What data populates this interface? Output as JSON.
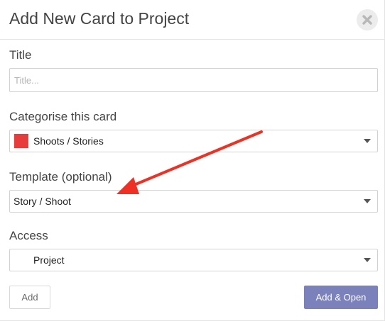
{
  "dialog": {
    "title": "Add New Card to Project",
    "close_icon": "close-icon"
  },
  "fields": {
    "title": {
      "label": "Title",
      "placeholder": "Title...",
      "value": ""
    },
    "category": {
      "label": "Categorise this card",
      "selected": "Shoots / Stories",
      "swatch_color": "#e83b3b"
    },
    "template": {
      "label": "Template (optional)",
      "selected": "Story / Shoot"
    },
    "access": {
      "label": "Access",
      "selected": "Project"
    }
  },
  "actions": {
    "add_label": "Add",
    "add_open_label": "Add & Open"
  },
  "colors": {
    "primary_button": "#7b82bb",
    "annotation_arrow": "#ee3124"
  }
}
